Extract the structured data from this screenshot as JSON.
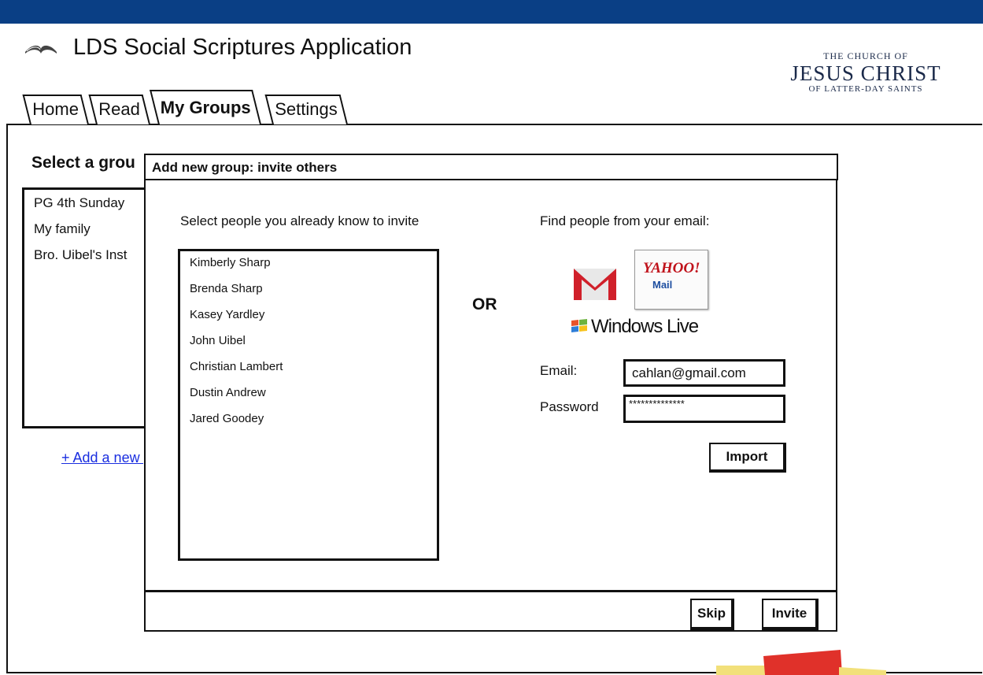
{
  "app": {
    "title": "LDS Social Scriptures Application",
    "logo": {
      "line1": "THE CHURCH OF",
      "line2": "JESUS CHRIST",
      "line3": "OF LATTER-DAY SAINTS"
    }
  },
  "tabs": [
    {
      "label": "Home"
    },
    {
      "label": "Read"
    },
    {
      "label": "My Groups"
    },
    {
      "label": "Settings"
    }
  ],
  "groups_panel": {
    "heading": "Select a grou",
    "groups": [
      "PG 4th Sunday",
      "My family",
      "Bro. Uibel's Inst"
    ],
    "add_link": "+ Add a new group"
  },
  "dialog": {
    "title": "Add new group: invite others",
    "left_prompt": "Select people you already know to invite",
    "people": [
      "Kimberly Sharp",
      "Brenda Sharp",
      "Kasey Yardley",
      "John Uibel",
      "Christian Lambert",
      "Dustin Andrew",
      "Jared Goodey"
    ],
    "or_label": "OR",
    "right_prompt": "Find people from your email:",
    "providers": {
      "yahoo_line1": "YAHOO!",
      "yahoo_line2": "Mail",
      "windows_live": "Windows Live"
    },
    "email_label": "Email:",
    "email_value": "cahlan@gmail.com",
    "password_label": "Password",
    "password_value": "**************",
    "import_label": "Import",
    "skip_label": "Skip",
    "invite_label": "Invite"
  },
  "colors": {
    "topbar": "#0a3f85",
    "link": "#1a2ee0",
    "gmail_red": "#d0202a"
  }
}
